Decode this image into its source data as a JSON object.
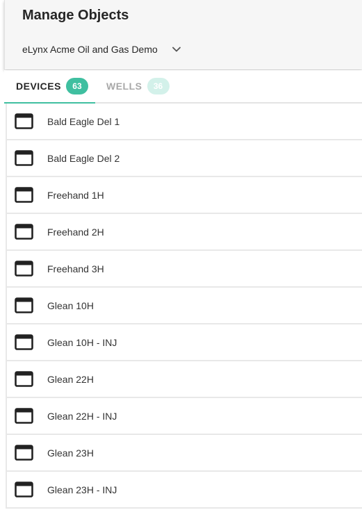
{
  "page": {
    "title": "Manage Objects"
  },
  "org_selector": {
    "selected": "eLynx Acme Oil and Gas Demo",
    "icon": "chevron-down-icon"
  },
  "tabs": [
    {
      "label": "DEVICES",
      "count": "63",
      "active": true
    },
    {
      "label": "WELLS",
      "count": "36",
      "active": false
    }
  ],
  "colors": {
    "accent": "#3fbfa0",
    "accent_light": "#d3f1ea",
    "header_bg": "#f6f6f6"
  },
  "devices": [
    {
      "name": "Bald Eagle Del 1",
      "icon": "device-window-icon"
    },
    {
      "name": "Bald Eagle Del 2",
      "icon": "device-window-icon"
    },
    {
      "name": "Freehand 1H",
      "icon": "device-window-icon"
    },
    {
      "name": "Freehand 2H",
      "icon": "device-window-icon"
    },
    {
      "name": "Freehand 3H",
      "icon": "device-window-icon"
    },
    {
      "name": "Glean 10H",
      "icon": "device-window-icon"
    },
    {
      "name": "Glean 10H - INJ",
      "icon": "device-window-icon"
    },
    {
      "name": "Glean 22H",
      "icon": "device-window-icon"
    },
    {
      "name": "Glean 22H - INJ",
      "icon": "device-window-icon"
    },
    {
      "name": "Glean 23H",
      "icon": "device-window-icon"
    },
    {
      "name": "Glean 23H - INJ",
      "icon": "device-window-icon"
    }
  ]
}
